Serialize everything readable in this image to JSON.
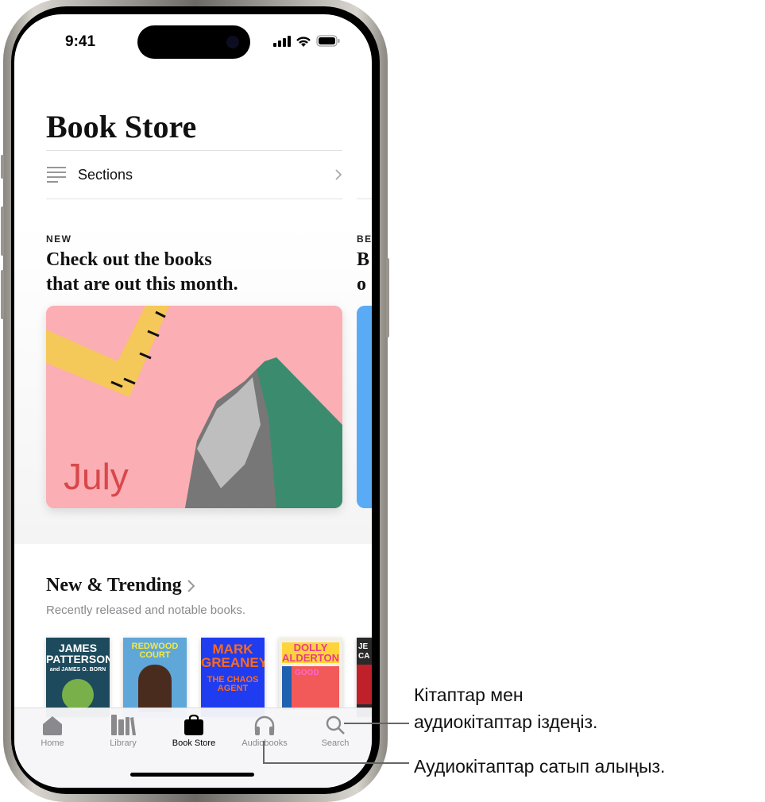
{
  "status_bar": {
    "time": "9:41"
  },
  "header": {
    "title": "Book Store"
  },
  "sections_row": {
    "label": "Sections"
  },
  "promo": {
    "eyebrow": "NEW",
    "headline_1": "Check out the books",
    "headline_2": "that are out this month.",
    "card_text": "July",
    "next_eyebrow": "BE",
    "next_headline_1": "B",
    "next_headline_2": "o"
  },
  "trending": {
    "title": "New & Trending",
    "subtitle": "Recently released and notable books.",
    "books": [
      {
        "author": "JAMES PATTERSON",
        "sub": "and JAMES O. BORN",
        "color": "#1d4a5c"
      },
      {
        "author": "REDWOOD COURT",
        "sub": "",
        "color": "#5fa6d9"
      },
      {
        "author": "MARK GREANEY",
        "sub": "THE CHAOS AGENT",
        "color": "#1f3cf0"
      },
      {
        "author": "DOLLY ALDERTON",
        "sub": "GOOD",
        "color": "#f4efe4"
      },
      {
        "author": "JE CA",
        "sub": "",
        "color": "#2a2a2a"
      }
    ]
  },
  "tabbar": {
    "tabs": [
      {
        "label": "Home",
        "icon": "house-icon",
        "active": false
      },
      {
        "label": "Library",
        "icon": "books-icon",
        "active": false
      },
      {
        "label": "Book Store",
        "icon": "bag-icon",
        "active": true
      },
      {
        "label": "Audiobooks",
        "icon": "headphones-icon",
        "active": false
      },
      {
        "label": "Search",
        "icon": "search-icon",
        "active": false
      }
    ]
  },
  "callouts": {
    "search_1": "Кітаптар мен",
    "search_2": "аудиокітаптар іздеңіз.",
    "audiobooks": "Аудиокітаптар сатып алыңыз."
  }
}
